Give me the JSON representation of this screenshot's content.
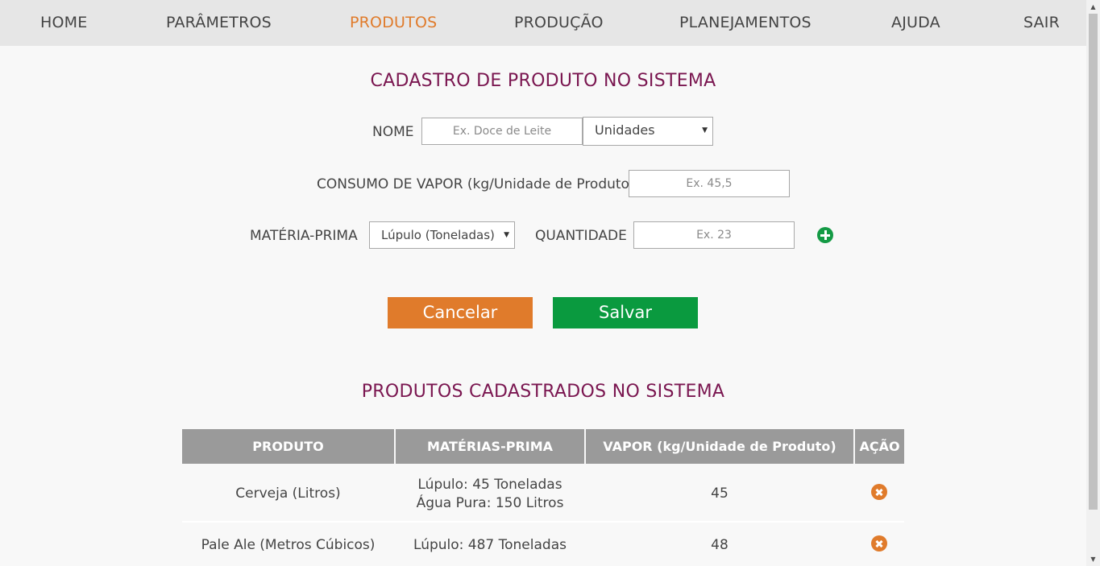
{
  "nav": {
    "items": [
      {
        "label": "HOME"
      },
      {
        "label": "PARÂMETROS"
      },
      {
        "label": "PRODUTOS",
        "active": true
      },
      {
        "label": "PRODUÇÃO"
      },
      {
        "label": "PLANEJAMENTOS"
      },
      {
        "label": "AJUDA"
      },
      {
        "label": "SAIR"
      }
    ]
  },
  "form": {
    "title": "CADASTRO DE PRODUTO NO SISTEMA",
    "name_label": "NOME",
    "name_placeholder": "Ex. Doce de Leite",
    "name_value": "",
    "unit_select": "Unidades",
    "steam_label": "CONSUMO DE VAPOR (kg/Unidade de Produto)",
    "steam_placeholder": "Ex. 45,5",
    "steam_value": "",
    "material_label": "MATÉRIA-PRIMA",
    "material_select": "Lúpulo (Toneladas)",
    "quantity_label": "QUANTIDADE",
    "quantity_placeholder": "Ex. 23",
    "quantity_value": "",
    "cancel_label": "Cancelar",
    "save_label": "Salvar"
  },
  "table": {
    "title": "PRODUTOS CADASTRADOS NO SISTEMA",
    "headers": [
      "PRODUTO",
      "MATÉRIAS-PRIMA",
      "VAPOR (kg/Unidade de Produto)",
      "AÇÃO"
    ],
    "rows": [
      {
        "product": "Cerveja (Litros)",
        "materials": [
          "Lúpulo: 45 Toneladas",
          "Água Pura: 150 Litros"
        ],
        "steam": "45"
      },
      {
        "product": "Pale Ale (Metros Cúbicos)",
        "materials": [
          "Lúpulo: 487 Toneladas"
        ],
        "steam": "48"
      }
    ]
  },
  "colors": {
    "accent": "#e07b2b",
    "title": "#7a1650",
    "save": "#0a9a3f",
    "nav_bg": "#e6e6e6",
    "header_bg": "#9a9a9a"
  }
}
